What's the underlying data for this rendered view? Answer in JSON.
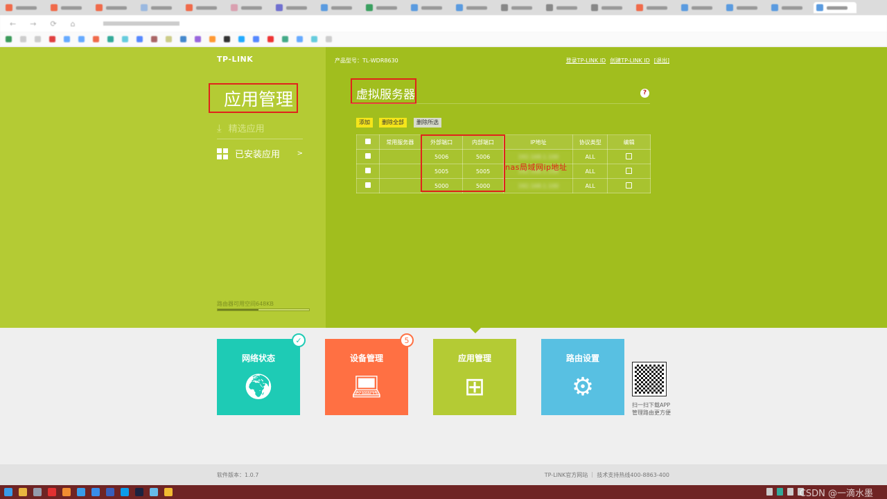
{
  "browser": {
    "tab_count": 20,
    "favicon_colors": [
      "#f06a4a",
      "#f06a4a",
      "#f06a4a",
      "#9ab8e0",
      "#f06a4a",
      "#d9a0b0",
      "#7070d0",
      "#5a9be0",
      "#3aa060",
      "#5a9be0",
      "#5a9be0",
      "#888",
      "#888",
      "#888",
      "#f06a4a",
      "#5a9be0",
      "#5a9be0",
      "#5a9be0",
      "#5a9be0"
    ]
  },
  "header": {
    "logo": "TP-LINK",
    "model_label": "产品型号：TL-WDR8630",
    "links": [
      "登录TP-LINK ID",
      "创建TP-LINK ID",
      "[退出]"
    ]
  },
  "sidebar": {
    "title": "应用管理",
    "items": [
      {
        "label": "精选应用",
        "icon": "download-icon"
      },
      {
        "label": "已安装应用",
        "icon": "grid-icon",
        "arrow": ">"
      }
    ],
    "storage_label": "路由器可用空间648KB",
    "storage_fraction": 0.45
  },
  "content": {
    "title": "虚拟服务器",
    "help": "?",
    "buttons": [
      "添加",
      "删除全部",
      "删除所选"
    ],
    "table": {
      "headers": [
        "常用服务器",
        "外部端口",
        "内部端口",
        "IP地址",
        "协议类型",
        "编辑"
      ],
      "rows": [
        {
          "server": "",
          "ext": "5006",
          "int": "5006",
          "ip": "192.168.1.100",
          "proto": "ALL"
        },
        {
          "server": "",
          "ext": "5005",
          "int": "5005",
          "ip": "192.168.1.100",
          "proto": "ALL"
        },
        {
          "server": "",
          "ext": "5000",
          "int": "5000",
          "ip": "192.168.1.100",
          "proto": "ALL"
        }
      ]
    },
    "annotation": "nas局域网ip地址"
  },
  "tiles": [
    {
      "label": "网络状态",
      "color": "#1ecbb5",
      "icon": "globe-icon",
      "badge": "✓"
    },
    {
      "label": "设备管理",
      "color": "#ff7043",
      "icon": "laptop-icon",
      "badge": "5"
    },
    {
      "label": "应用管理",
      "color": "#b4cb34",
      "icon": "apps-icon"
    },
    {
      "label": "路由设置",
      "color": "#58c0e2",
      "icon": "gear-icon"
    }
  ],
  "qr": {
    "text": "扫一扫下载APP管理路由更方便"
  },
  "footer": {
    "version": "软件版本：1.0.7",
    "site": "TP-LINK官方网站",
    "hotline": "技术支持热线400-8863-400"
  },
  "watermark": "CSDN @一滴水墨"
}
